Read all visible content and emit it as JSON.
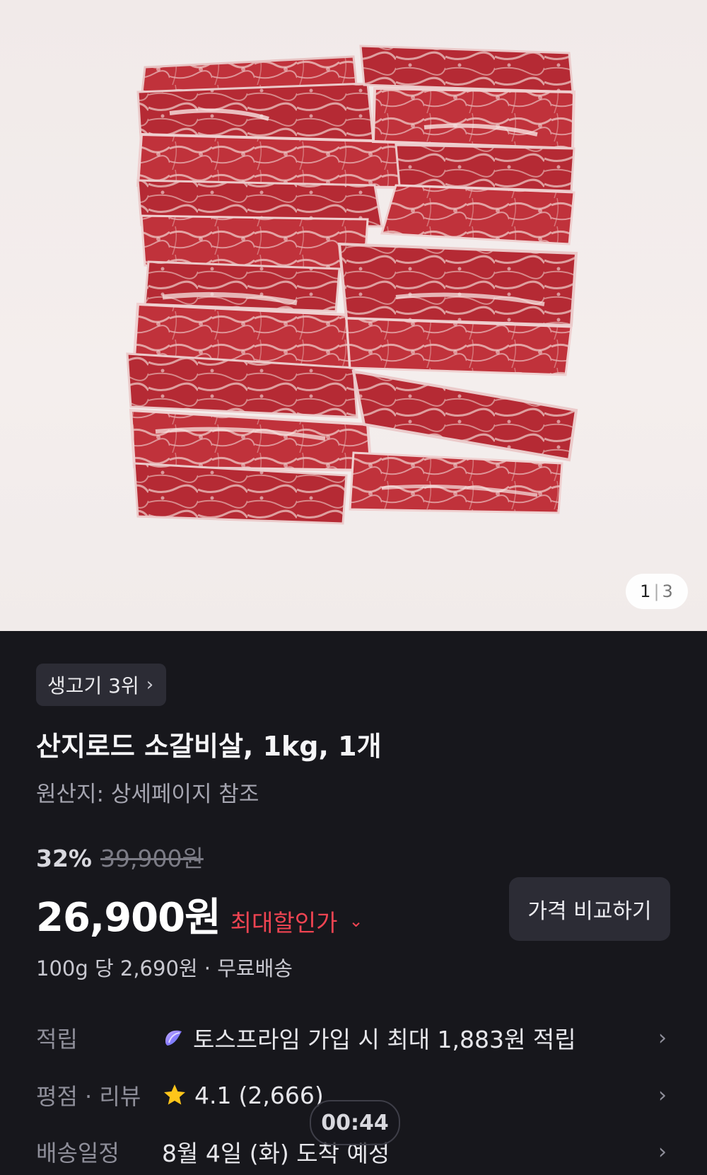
{
  "image": {
    "counter_current": "1",
    "counter_separator": "|",
    "counter_total": "3"
  },
  "rank_chip": {
    "label": "생고기 3위"
  },
  "product": {
    "title": "산지로드 소갈비살, 1kg, 1개",
    "origin": "원산지: 상세페이지 참조",
    "discount_percent": "32%",
    "original_price": "39,900원",
    "price": "26,900원",
    "max_discount_label": "최대할인가",
    "unit_price_and_shipping": "100g 당 2,690원 · 무료배송"
  },
  "compare_button": {
    "label": "가격 비교하기"
  },
  "info": {
    "points": {
      "label": "적립",
      "value": "토스프라임 가입 시 최대 1,883원 적립"
    },
    "rating": {
      "label": "평점 · 리뷰",
      "score": "4.1",
      "count": "(2,666)"
    },
    "delivery": {
      "label": "배송일정",
      "value": "8월 4일 (화) 도착 예정"
    }
  },
  "video_timer": "00:44",
  "colors": {
    "background": "#17171c",
    "discount_accent": "#f04452",
    "chip_background": "#2c2c35",
    "star": "#ffc51a"
  }
}
